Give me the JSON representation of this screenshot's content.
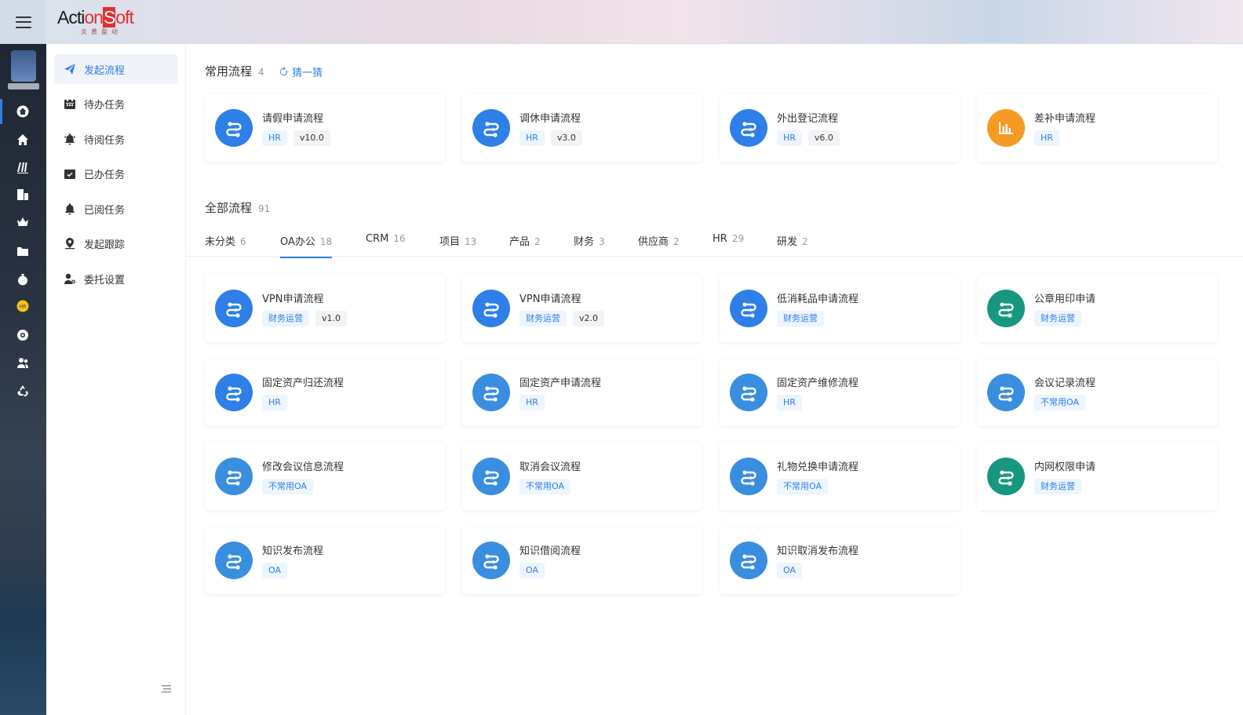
{
  "brand": {
    "logo_a": "Acti",
    "logo_b": "on",
    "logo_c": "S",
    "logo_d": "oft",
    "sub": "炎黄盈动"
  },
  "nav": [
    {
      "label": "发起流程",
      "icon": "send-icon",
      "active": true
    },
    {
      "label": "待办任务",
      "icon": "calendar-icon"
    },
    {
      "label": "待阅任务",
      "icon": "bell-ring-icon"
    },
    {
      "label": "已办任务",
      "icon": "calendar-check-icon"
    },
    {
      "label": "已阅任务",
      "icon": "bell-icon"
    },
    {
      "label": "发起跟踪",
      "icon": "location-pin-icon"
    },
    {
      "label": "委托设置",
      "icon": "user-gear-icon"
    }
  ],
  "common": {
    "title": "常用流程",
    "count": "4",
    "guess": "猜一猜",
    "cards": [
      {
        "title": "请假申请流程",
        "tags": [
          "HR"
        ],
        "version": "v10.0",
        "color": "#2e7fe8",
        "icon": "flow-icon"
      },
      {
        "title": "调休申请流程",
        "tags": [
          "HR"
        ],
        "version": "v3.0",
        "color": "#2e7fe8",
        "icon": "flow-icon"
      },
      {
        "title": "外出登记流程",
        "tags": [
          "HR"
        ],
        "version": "v6.0",
        "color": "#2e7fe8",
        "icon": "flow-icon"
      },
      {
        "title": "差补申请流程",
        "tags": [
          "HR"
        ],
        "version": "",
        "color": "#f59a23",
        "icon": "bar-chart-icon"
      }
    ]
  },
  "all": {
    "title": "全部流程",
    "count": "91",
    "tabs": [
      {
        "label": "未分类",
        "count": "6"
      },
      {
        "label": "OA办公",
        "count": "18",
        "active": true
      },
      {
        "label": "CRM",
        "count": "16"
      },
      {
        "label": "项目",
        "count": "13"
      },
      {
        "label": "产品",
        "count": "2"
      },
      {
        "label": "财务",
        "count": "3"
      },
      {
        "label": "供应商",
        "count": "2"
      },
      {
        "label": "HR",
        "count": "29"
      },
      {
        "label": "研发",
        "count": "2"
      }
    ],
    "cards": [
      {
        "title": "VPN申请流程",
        "tags": [
          "财务运营"
        ],
        "version": "v1.0",
        "color": "#2e7fe8"
      },
      {
        "title": "VPN申请流程",
        "tags": [
          "财务运营"
        ],
        "version": "v2.0",
        "color": "#2e7fe8"
      },
      {
        "title": "低消耗品申请流程",
        "tags": [
          "财务运营"
        ],
        "version": "",
        "color": "#2e7fe8"
      },
      {
        "title": "公章用印申请",
        "tags": [
          "财务运营"
        ],
        "version": "",
        "color": "#17977f"
      },
      {
        "title": "固定资产归还流程",
        "tags": [
          "HR"
        ],
        "version": "",
        "color": "#2e7fe8"
      },
      {
        "title": "固定资产申请流程",
        "tags": [
          "HR"
        ],
        "version": "",
        "color": "#3a8ee0"
      },
      {
        "title": "固定资产维修流程",
        "tags": [
          "HR"
        ],
        "version": "",
        "color": "#3a8ee0"
      },
      {
        "title": "会议记录流程",
        "tags": [
          "不常用OA"
        ],
        "version": "",
        "color": "#3a8ee0"
      },
      {
        "title": "修改会议信息流程",
        "tags": [
          "不常用OA"
        ],
        "version": "",
        "color": "#3a8ee0"
      },
      {
        "title": "取消会议流程",
        "tags": [
          "不常用OA"
        ],
        "version": "",
        "color": "#3a8ee0"
      },
      {
        "title": "礼物兑换申请流程",
        "tags": [
          "不常用OA"
        ],
        "version": "",
        "color": "#3a8ee0"
      },
      {
        "title": "内网权限申请",
        "tags": [
          "财务运营"
        ],
        "version": "",
        "color": "#17977f"
      },
      {
        "title": "知识发布流程",
        "tags": [
          "OA"
        ],
        "version": "",
        "color": "#3a8ee0"
      },
      {
        "title": "知识借阅流程",
        "tags": [
          "OA"
        ],
        "version": "",
        "color": "#3a8ee0"
      },
      {
        "title": "知识取消发布流程",
        "tags": [
          "OA"
        ],
        "version": "",
        "color": "#3a8ee0"
      }
    ]
  },
  "iconbar": [
    "home-circle-icon",
    "home-icon",
    "books-icon",
    "building-icon",
    "crown-icon",
    "folder-icon",
    "money-bag-icon",
    "hr-badge-icon",
    "settings-circle-icon",
    "users-icon",
    "recycle-icon"
  ]
}
